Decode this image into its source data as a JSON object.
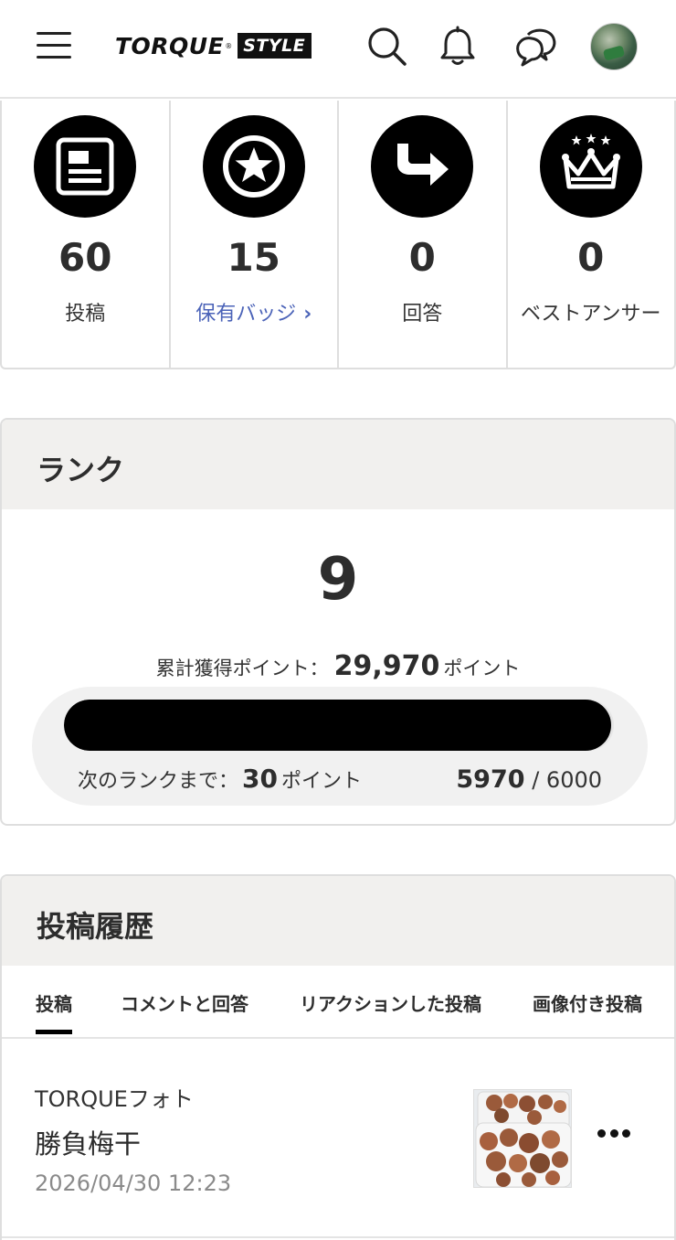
{
  "header": {
    "logo_main": "TORQUE",
    "logo_reg": "®",
    "logo_sub": "STYLE"
  },
  "stats": [
    {
      "icon": "article-icon",
      "value": "60",
      "label": "投稿"
    },
    {
      "icon": "badge-star-icon",
      "value": "15",
      "label": "保有バッジ",
      "chevron": "›"
    },
    {
      "icon": "answer-arrow-icon",
      "value": "0",
      "label": "回答"
    },
    {
      "icon": "crown-icon",
      "value": "0",
      "label": "ベストアンサー"
    }
  ],
  "rank": {
    "title": "ランク",
    "number": "9",
    "total_label": "累計獲得ポイント：",
    "total_points": "29,970",
    "total_unit": "ポイント",
    "progress_fraction": 0.995,
    "next_label": "次のランクまで：",
    "next_points": "30",
    "next_unit": "ポイント",
    "current": "5970",
    "separator": "/",
    "goal": "6000"
  },
  "history": {
    "title": "投稿履歴",
    "tabs": [
      "投稿",
      "コメントと回答",
      "リアクションした投稿",
      "画像付き投稿"
    ],
    "active_tab": 0,
    "posts": [
      {
        "category": "TORQUEフォト",
        "title": "勝負梅干",
        "date": "2026/04/30 12:23"
      }
    ]
  },
  "colors": {
    "accent_link": "#4b63b8",
    "progress_fill": "#000000",
    "section_head_bg": "#f1f0ee"
  }
}
